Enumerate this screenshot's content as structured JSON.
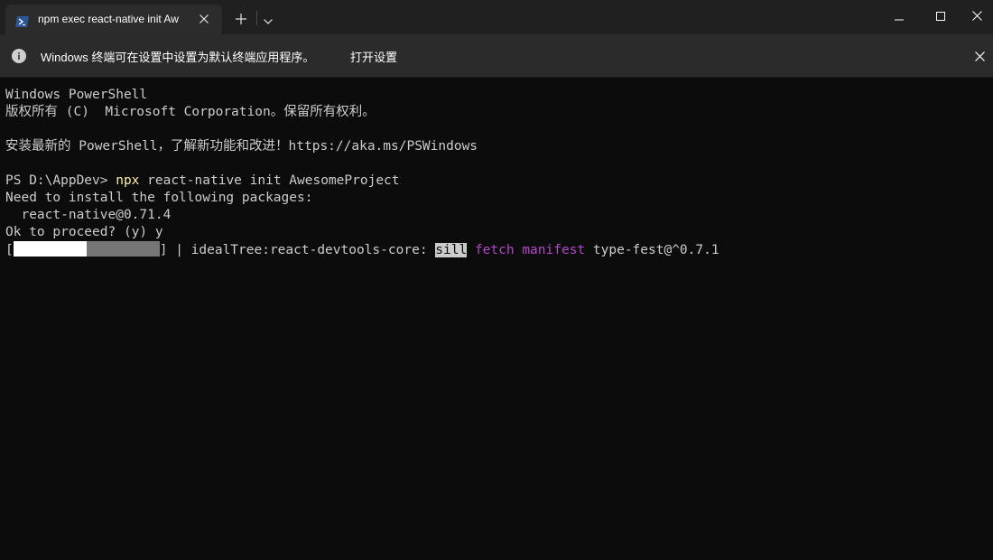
{
  "titlebar": {
    "tab_title": "npm exec react-native init Aw",
    "tab_icon": "powershell-icon",
    "new_tab_icon": "plus-icon",
    "dropdown_icon": "chevron-down-icon"
  },
  "infobar": {
    "message": "Windows 终端可在设置中设置为默认终端应用程序。",
    "link_label": "打开设置"
  },
  "terminal": {
    "line1": "Windows PowerShell",
    "line2": "版权所有 (C)  Microsoft Corporation。保留所有权利。",
    "line3": "",
    "line4": "安装最新的 PowerShell，了解新功能和改进！https://aka.ms/PSWindows",
    "line5": "",
    "prompt": "PS D:\\AppDev> ",
    "cmd_name": "npx",
    "cmd_args": " react-native init AwesomeProject",
    "line7": "Need to install the following packages:",
    "line8": "  react-native@0.71.4",
    "line9": "Ok to proceed? (y) y",
    "progress": {
      "open_bracket": "[",
      "close_bracket": "] | idealTree:react-devtools-core: ",
      "fraction": 0.5,
      "level": "sill",
      "sep": " ",
      "fetch": "fetch",
      "manifest": "manifest",
      "tail": " type-fest@^0.7.1"
    }
  },
  "colors": {
    "background": "#0c0c0c",
    "foreground": "#cccccc",
    "yellow": "#f9f1a5",
    "purple": "#b148c6",
    "titlebar": "#202020",
    "tab": "#2c2c2c",
    "infobar": "#2b2b2b"
  }
}
